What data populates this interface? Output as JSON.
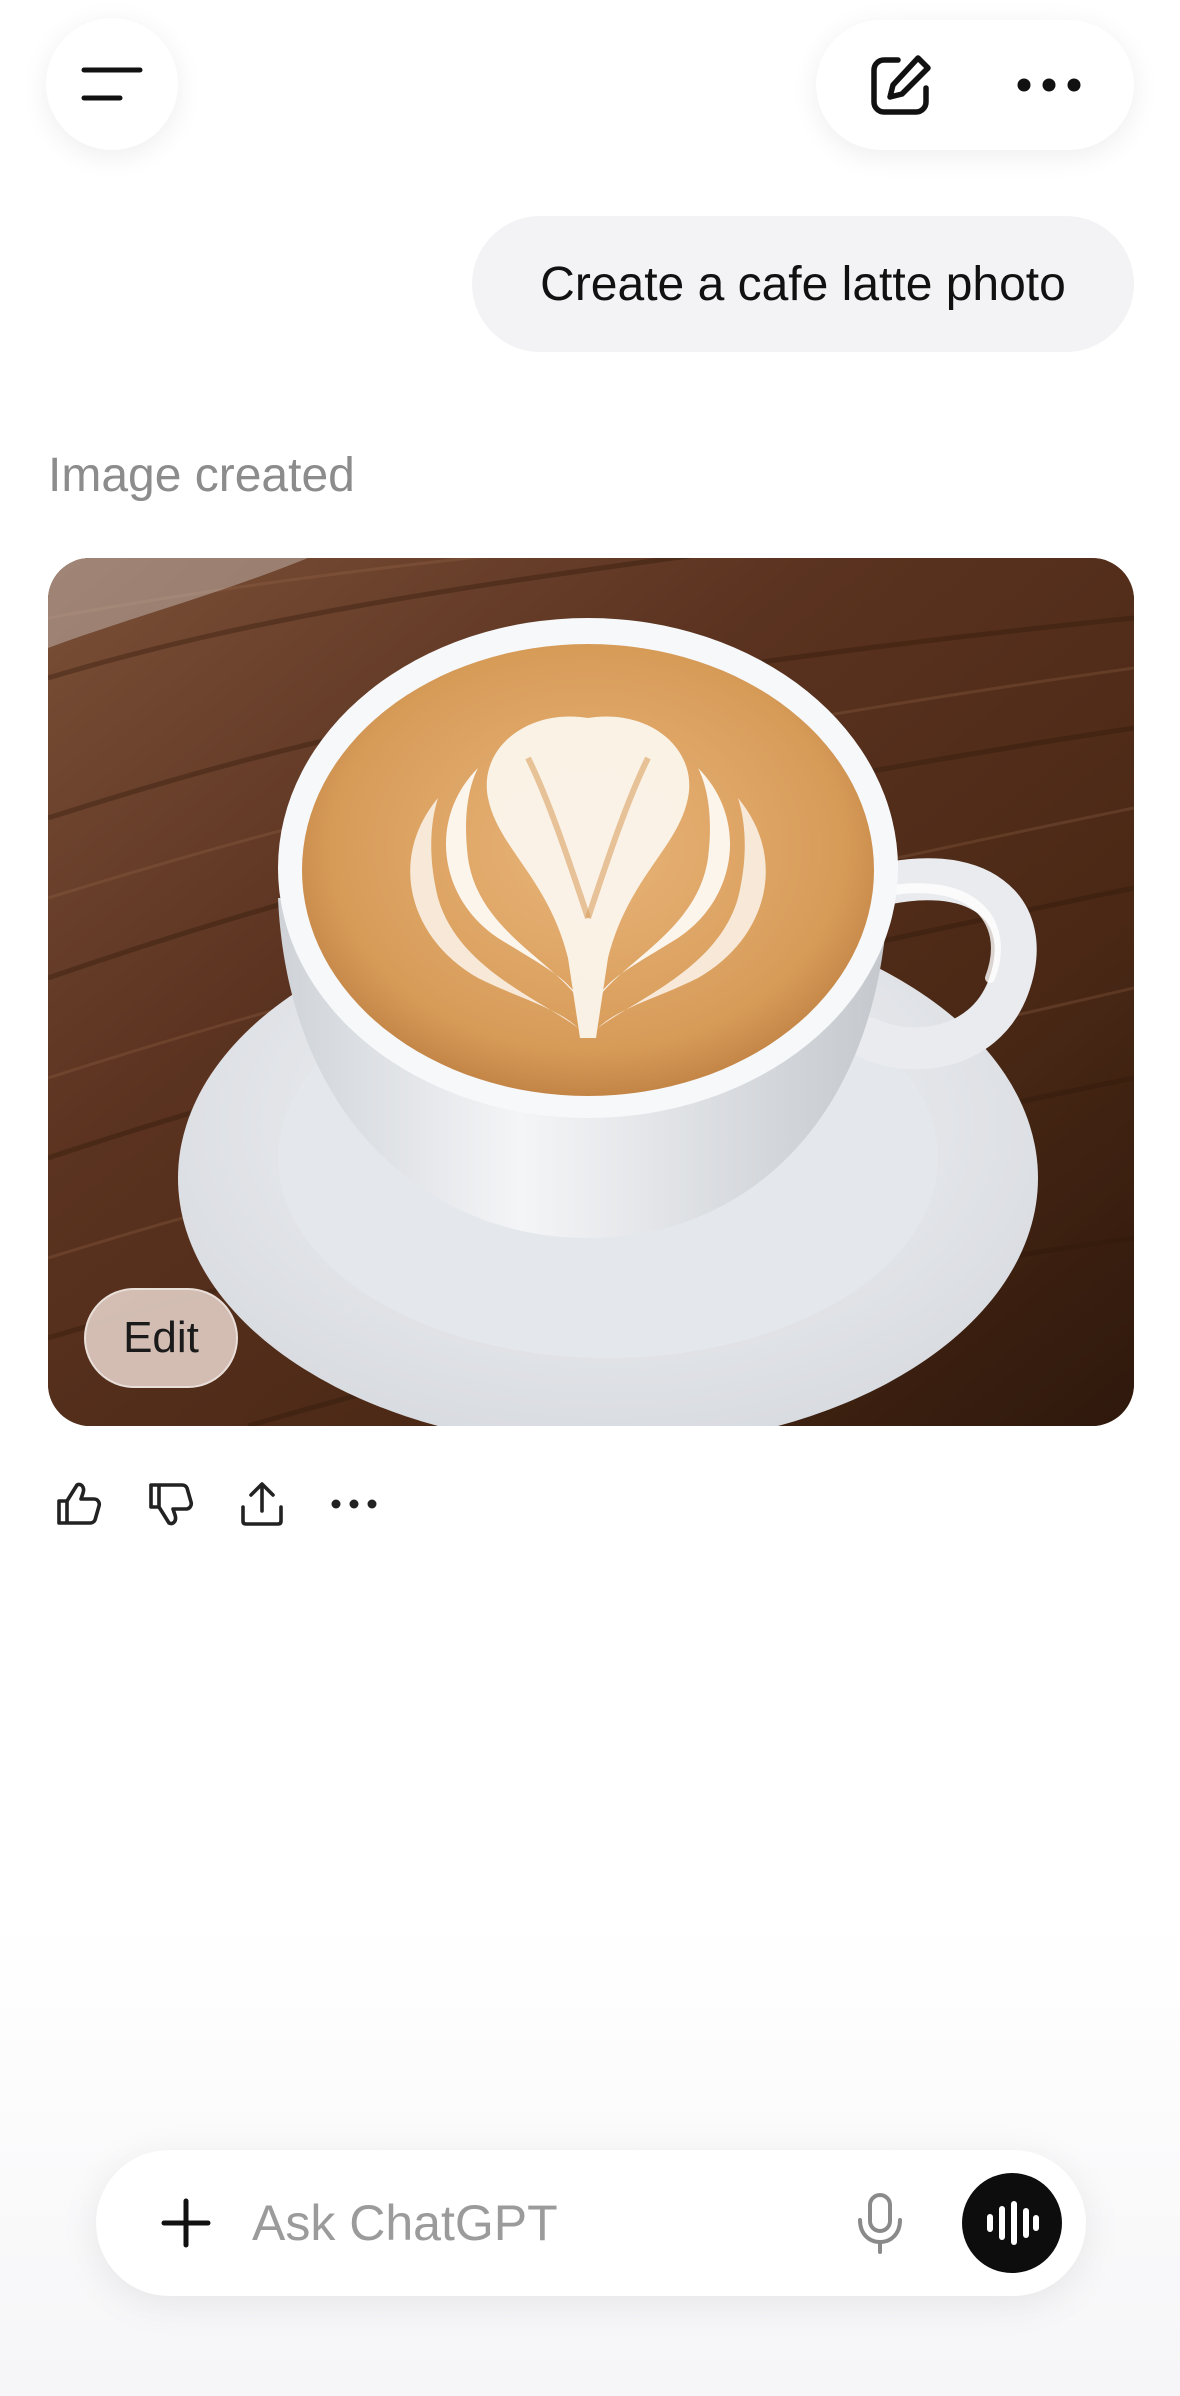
{
  "header": {
    "menu_icon": "menu-icon",
    "compose_icon": "new-chat-icon",
    "more_icon": "more-icon"
  },
  "conversation": {
    "user_message": "Create a cafe latte photo",
    "status_label": "Image created",
    "image": {
      "subject": "cafe-latte-photo",
      "edit_label": "Edit"
    },
    "actions": [
      "thumbs-up-icon",
      "thumbs-down-icon",
      "share-icon",
      "more-icon"
    ]
  },
  "composer": {
    "placeholder": "Ask ChatGPT",
    "value": "",
    "plus_icon": "plus-icon",
    "mic_icon": "microphone-icon",
    "voice_icon": "voice-mode-icon"
  },
  "colors": {
    "bubble_bg": "#f3f3f5",
    "muted_text": "#8c8c8c",
    "voice_button": "#0d0d0d"
  }
}
